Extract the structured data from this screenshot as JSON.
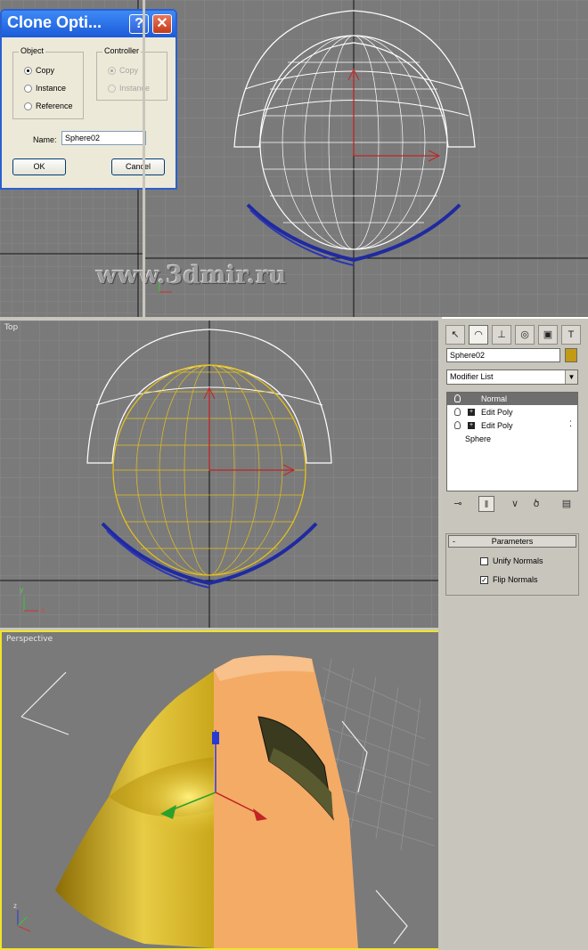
{
  "dialog": {
    "title": "Clone Opti...",
    "help_glyph": "?",
    "close_glyph": "✕",
    "object_group": {
      "title": "Object",
      "options": [
        "Copy",
        "Instance",
        "Reference"
      ],
      "selected": "Copy"
    },
    "controller_group": {
      "title": "Controller",
      "options": [
        "Copy",
        "Instance"
      ],
      "selected": "Copy",
      "disabled": true
    },
    "name_label": "Name:",
    "name_value": "Sphere02",
    "ok_label": "OK",
    "cancel_label": "Cancel"
  },
  "watermark": "www.3dmir.ru",
  "viewports": {
    "top_label": "Top",
    "perspective_label": "Perspective",
    "axis_labels": {
      "x": "x",
      "y": "y",
      "z": "z"
    }
  },
  "panel": {
    "tabs": [
      "create-icon",
      "modify-icon",
      "hierarchy-icon",
      "motion-icon",
      "display-icon",
      "utilities-icon"
    ],
    "object_name": "Sphere02",
    "object_color": "#c39a13",
    "modifier_list_label": "Modifier List",
    "stack": [
      {
        "label": "Normal",
        "selected": true
      },
      {
        "label": "Edit Poly",
        "selected": false
      },
      {
        "label": "Edit Poly",
        "selected": false
      },
      {
        "label": "Sphere",
        "selected": false
      }
    ],
    "parameters": {
      "title": "Parameters",
      "collapse_glyph": "-",
      "unify_normals": {
        "label": "Unify Normals",
        "checked": false
      },
      "flip_normals": {
        "label": "Flip Normals",
        "checked": true
      }
    }
  },
  "colors": {
    "viewport_bg": "#7a7a7a",
    "wire_white": "#ffffff",
    "wire_yellow": "#e5c11a",
    "wire_blue": "#1f2aa0",
    "active_viewport_border": "#f0e52a"
  }
}
